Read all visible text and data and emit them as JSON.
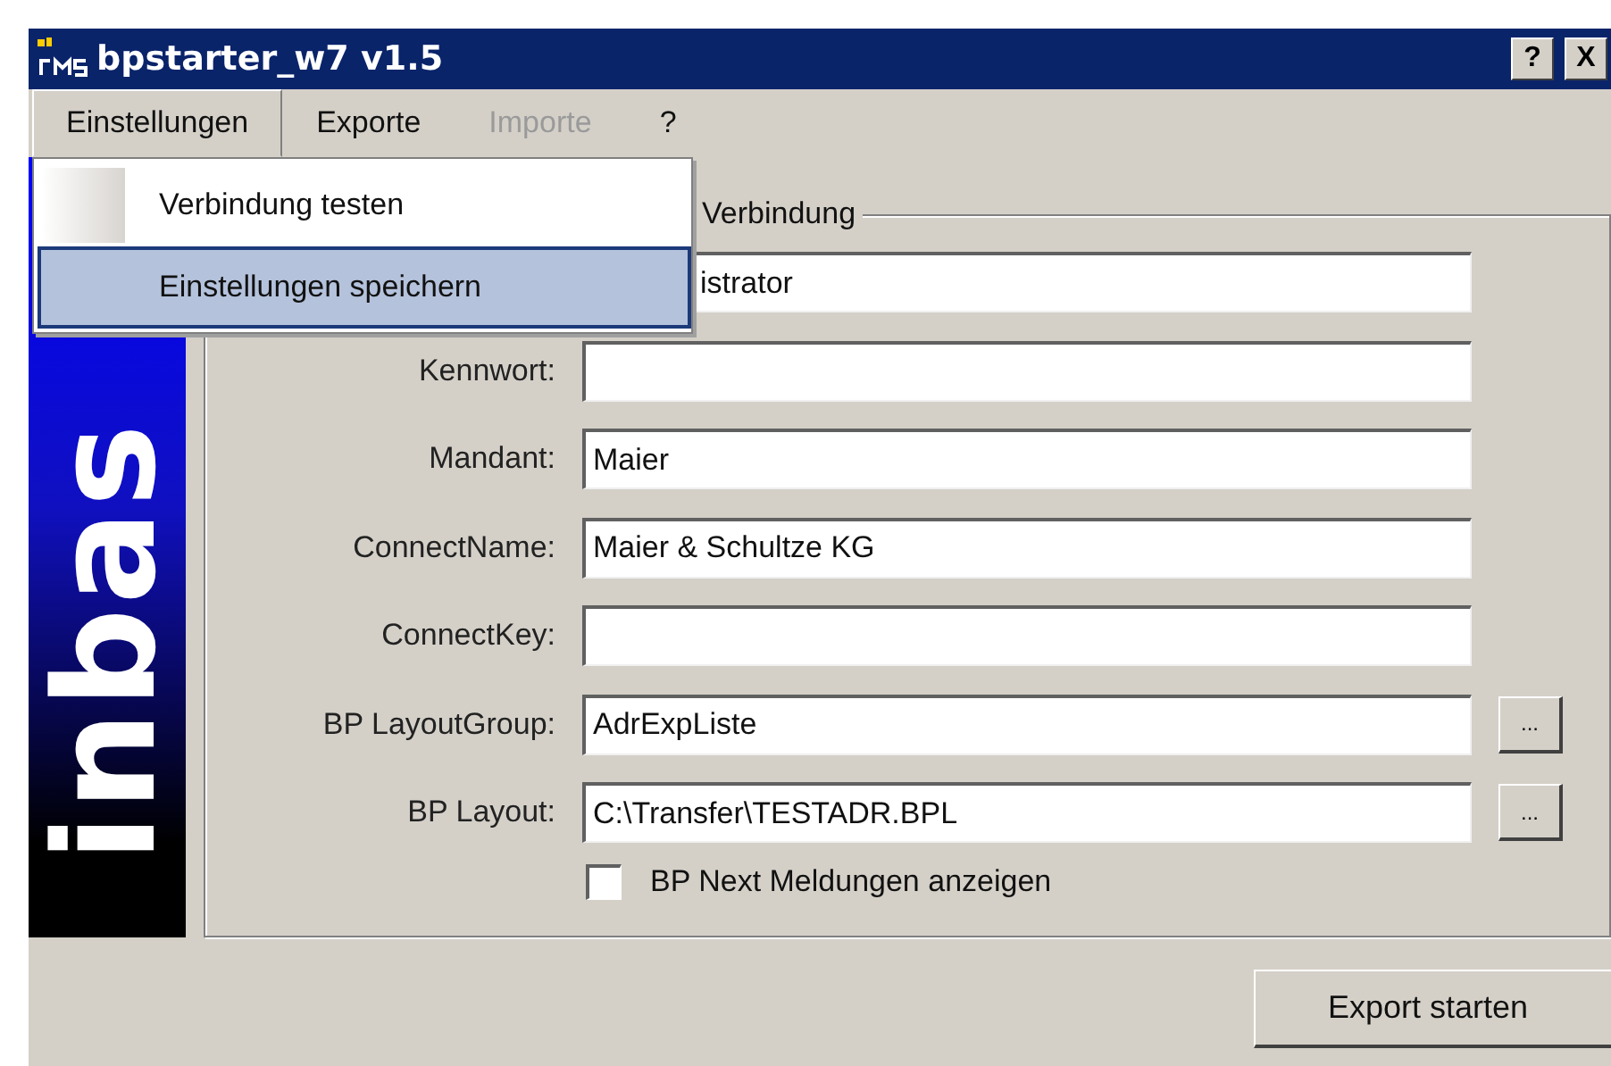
{
  "window": {
    "title": "bpstarter_w7 v1.5",
    "title_buttons": [
      "?",
      "X"
    ]
  },
  "menu": [
    {
      "label": "Einstellungen",
      "selected": true,
      "disabled": false
    },
    {
      "label": "Exporte",
      "selected": false,
      "disabled": false
    },
    {
      "label": "Importe",
      "selected": false,
      "disabled": true
    },
    {
      "label": "?",
      "selected": false,
      "disabled": false
    }
  ],
  "dropdown": [
    {
      "label": "Verbindung testen",
      "selected": false
    },
    {
      "label": "Einstellungen speichern",
      "selected": true
    }
  ],
  "logo": {
    "text": "inbas"
  },
  "group": {
    "legend": "Verbindung",
    "rows": [
      {
        "value": "istrator"
      },
      {
        "label": "Kennwort:",
        "value": ""
      },
      {
        "label": "Mandant:",
        "value": "Maier"
      },
      {
        "label": "ConnectName:",
        "value": "Maier & Schultze KG"
      },
      {
        "label": "ConnectKey:",
        "value": ""
      },
      {
        "label": "BP LayoutGroup:",
        "value": "AdrExpListe",
        "browse": "..."
      },
      {
        "label": "BP Layout:",
        "value": "C:\\Transfer\\TESTADR.BPL",
        "browse": "..."
      }
    ],
    "checkbox": {
      "label": "BP Next Meldungen anzeigen",
      "checked": false
    }
  },
  "export_button": "Export starten"
}
